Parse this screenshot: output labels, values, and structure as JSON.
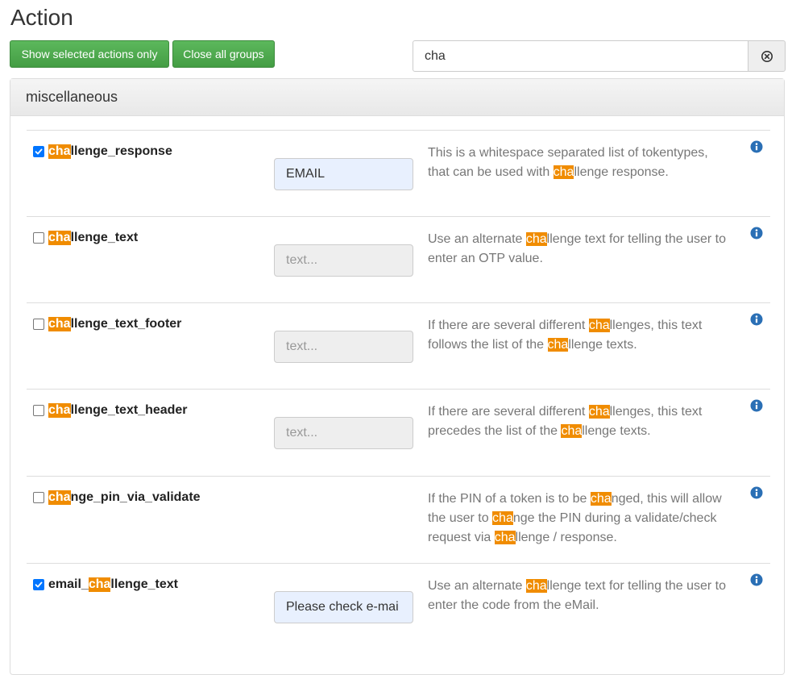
{
  "page": {
    "title": "Action"
  },
  "toolbar": {
    "show_selected_label": "Show selected actions only",
    "close_groups_label": "Close all groups",
    "search_value": "cha"
  },
  "colors": {
    "highlight": "#f08c00",
    "button_green": "#5cb85c",
    "info_blue": "#2a6fb5"
  },
  "group": {
    "name": "miscellaneous",
    "actions": [
      {
        "checked": true,
        "name_parts": [
          [
            "cha",
            true
          ],
          [
            "llenge_response",
            false
          ]
        ],
        "input_value": "EMAIL",
        "input_placeholder": "",
        "has_input": true,
        "desc_parts": [
          [
            "This is a whitespace separated list of tokentypes, that can be used with ",
            false
          ],
          [
            "cha",
            true
          ],
          [
            "llenge response.",
            false
          ]
        ]
      },
      {
        "checked": false,
        "name_parts": [
          [
            "cha",
            true
          ],
          [
            "llenge_text",
            false
          ]
        ],
        "input_value": "",
        "input_placeholder": "text...",
        "has_input": true,
        "desc_parts": [
          [
            "Use an alternate ",
            false
          ],
          [
            "cha",
            true
          ],
          [
            "llenge text for telling the user to enter an OTP value.",
            false
          ]
        ]
      },
      {
        "checked": false,
        "name_parts": [
          [
            "cha",
            true
          ],
          [
            "llenge_text_footer",
            false
          ]
        ],
        "input_value": "",
        "input_placeholder": "text...",
        "has_input": true,
        "desc_parts": [
          [
            "If there are several different ",
            false
          ],
          [
            "cha",
            true
          ],
          [
            "llenges, this text follows the list of the ",
            false
          ],
          [
            "cha",
            true
          ],
          [
            "llenge texts.",
            false
          ]
        ]
      },
      {
        "checked": false,
        "name_parts": [
          [
            "cha",
            true
          ],
          [
            "llenge_text_header",
            false
          ]
        ],
        "input_value": "",
        "input_placeholder": "text...",
        "has_input": true,
        "desc_parts": [
          [
            "If there are several different ",
            false
          ],
          [
            "cha",
            true
          ],
          [
            "llenges, this text precedes the list of the ",
            false
          ],
          [
            "cha",
            true
          ],
          [
            "llenge texts.",
            false
          ]
        ]
      },
      {
        "checked": false,
        "name_parts": [
          [
            "cha",
            true
          ],
          [
            "nge_pin_via_validate",
            false
          ]
        ],
        "input_value": "",
        "input_placeholder": "",
        "has_input": false,
        "desc_parts": [
          [
            "If the PIN of a token is to be ",
            false
          ],
          [
            "cha",
            true
          ],
          [
            "nged, this will allow the user to ",
            false
          ],
          [
            "cha",
            true
          ],
          [
            "nge the PIN during a validate/check request via ",
            false
          ],
          [
            "cha",
            true
          ],
          [
            "llenge / response.",
            false
          ]
        ]
      },
      {
        "checked": true,
        "name_parts": [
          [
            "email_",
            false
          ],
          [
            "cha",
            true
          ],
          [
            "llenge_text",
            false
          ]
        ],
        "input_value": "Please check e-mai",
        "input_placeholder": "",
        "has_input": true,
        "desc_parts": [
          [
            "Use an alternate ",
            false
          ],
          [
            "cha",
            true
          ],
          [
            "llenge text for telling the user to enter the code from the eMail.",
            false
          ]
        ]
      }
    ]
  }
}
